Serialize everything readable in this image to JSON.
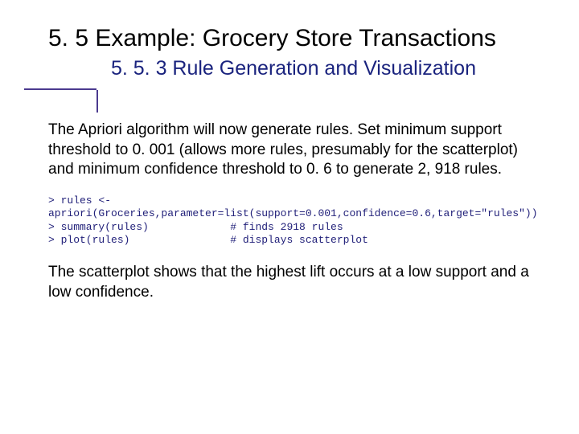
{
  "title": {
    "main": "5. 5 Example: Grocery Store Transactions",
    "sub": "5. 5. 3 Rule Generation and Visualization"
  },
  "paragraph1": "The Apriori algorithm will now generate rules.\nSet minimum support threshold to 0. 001 (allows more rules, presumably for the scatterplot) and minimum confidence threshold to 0. 6 to generate 2, 918 rules.",
  "code": "> rules <-\napriori(Groceries,parameter=list(support=0.001,confidence=0.6,target=\"rules\"))\n> summary(rules)             # finds 2918 rules\n> plot(rules)                # displays scatterplot",
  "paragraph2": "The scatterplot shows that the highest lift occurs at a low support and a low confidence."
}
